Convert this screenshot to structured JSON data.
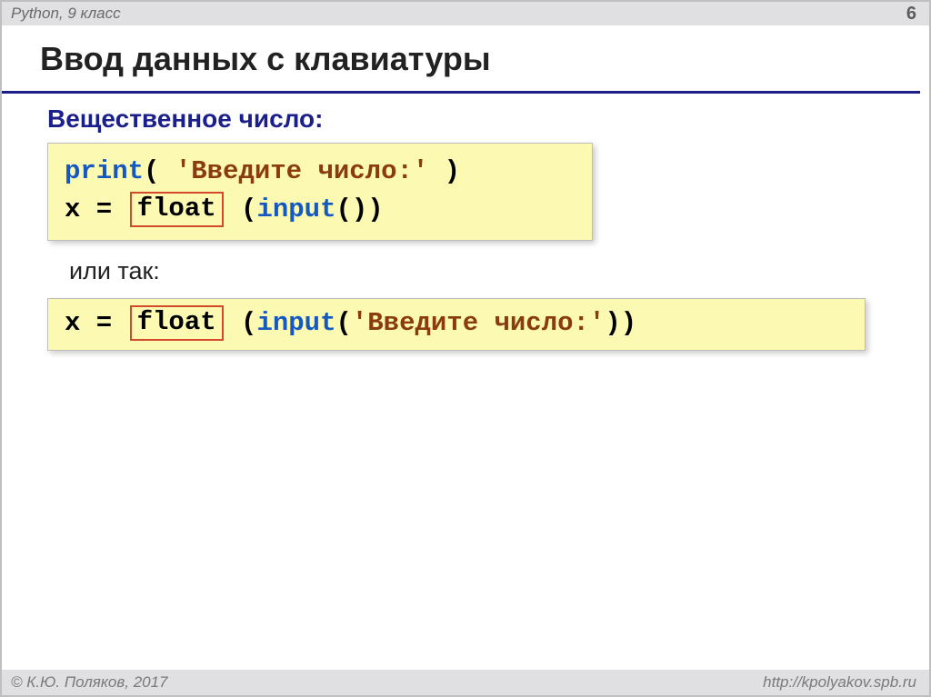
{
  "header": {
    "course": "Python, 9 класс",
    "page": "6"
  },
  "title": "Ввод данных с клавиатуры",
  "subheading": "Вещественное число:",
  "code1": {
    "print_kw": "print",
    "open1": "( ",
    "str1": "'Введите число:'",
    "close1": " )",
    "line2_pre": "x = ",
    "float_label": "float",
    "line2_mid": " (",
    "input_kw": "input",
    "line2_post": "())"
  },
  "or_text": "или так:",
  "code2": {
    "pre": "x = ",
    "float_label": "float",
    "mid": " (",
    "input_kw": "input",
    "paren_open": "(",
    "str": "'Введите число:'",
    "post": "))"
  },
  "footer": {
    "copyright": "© К.Ю. Поляков, 2017",
    "url": "http://kpolyakov.spb.ru"
  }
}
